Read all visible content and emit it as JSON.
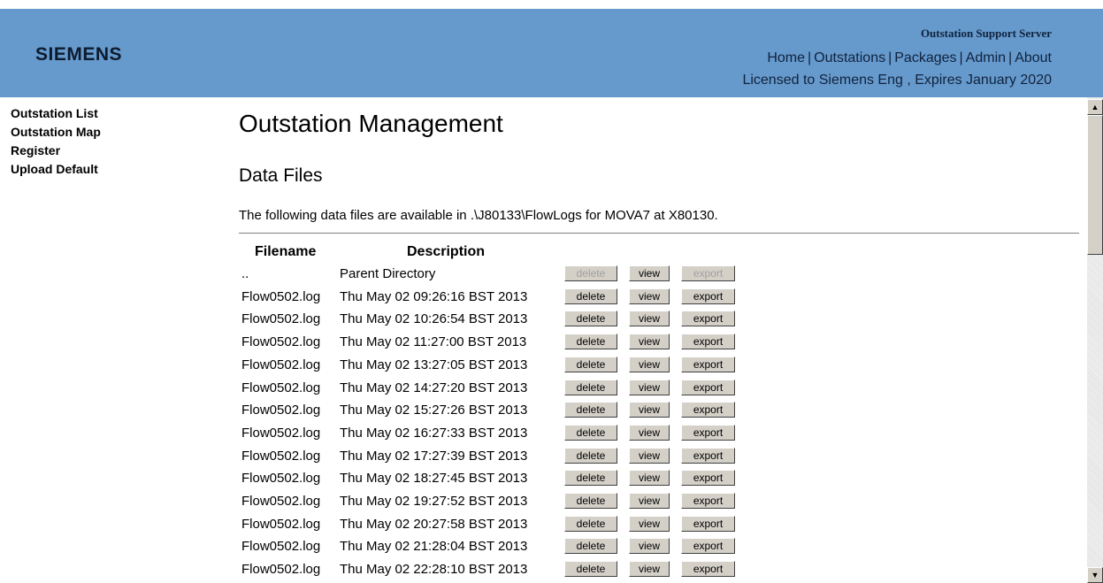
{
  "header": {
    "logo": "SIEMENS",
    "server_title": "Outstation Support Server",
    "nav": [
      "Home",
      "Outstations",
      "Packages",
      "Admin",
      "About"
    ],
    "license": "Licensed to Siemens Eng , Expires January 2020"
  },
  "sidebar": {
    "items": [
      "Outstation List",
      "Outstation Map",
      "Register",
      "Upload Default"
    ]
  },
  "main": {
    "title": "Outstation Management",
    "section": "Data Files",
    "intro": "The following data files are available in .\\J80133\\FlowLogs for MOVA7 at X80130.",
    "columns": {
      "filename": "Filename",
      "description": "Description"
    },
    "buttons": {
      "delete": "delete",
      "view": "view",
      "export": "export"
    },
    "rows": [
      {
        "filename": "..",
        "description": "Parent Directory",
        "disabled": true
      },
      {
        "filename": "Flow0502.log",
        "description": "Thu May 02 09:26:16 BST 2013"
      },
      {
        "filename": "Flow0502.log",
        "description": "Thu May 02 10:26:54 BST 2013"
      },
      {
        "filename": "Flow0502.log",
        "description": "Thu May 02 11:27:00 BST 2013"
      },
      {
        "filename": "Flow0502.log",
        "description": "Thu May 02 13:27:05 BST 2013"
      },
      {
        "filename": "Flow0502.log",
        "description": "Thu May 02 14:27:20 BST 2013"
      },
      {
        "filename": "Flow0502.log",
        "description": "Thu May 02 15:27:26 BST 2013"
      },
      {
        "filename": "Flow0502.log",
        "description": "Thu May 02 16:27:33 BST 2013"
      },
      {
        "filename": "Flow0502.log",
        "description": "Thu May 02 17:27:39 BST 2013"
      },
      {
        "filename": "Flow0502.log",
        "description": "Thu May 02 18:27:45 BST 2013"
      },
      {
        "filename": "Flow0502.log",
        "description": "Thu May 02 19:27:52 BST 2013"
      },
      {
        "filename": "Flow0502.log",
        "description": "Thu May 02 20:27:58 BST 2013"
      },
      {
        "filename": "Flow0502.log",
        "description": "Thu May 02 21:28:04 BST 2013"
      },
      {
        "filename": "Flow0502.log",
        "description": "Thu May 02 22:28:10 BST 2013"
      }
    ]
  },
  "colors": {
    "header_bg": "#6699cc",
    "button_face": "#d4d0c8"
  }
}
